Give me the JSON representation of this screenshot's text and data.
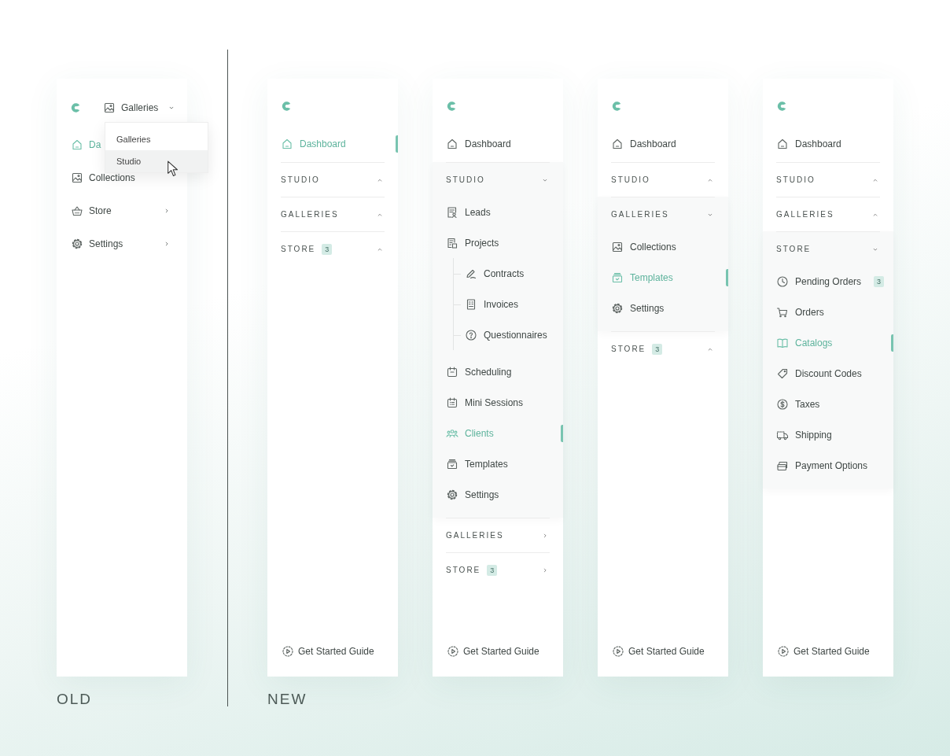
{
  "old": {
    "label": "OLD",
    "switcher": {
      "label": "Galleries"
    },
    "dropdown": [
      {
        "label": "Galleries",
        "selected": false
      },
      {
        "label": "Studio",
        "selected": true
      }
    ],
    "items": [
      {
        "label": "Da",
        "kind": "home",
        "selected": true,
        "submenu": false
      },
      {
        "label": "Collections",
        "kind": "image",
        "selected": false,
        "submenu": false
      },
      {
        "label": "Store",
        "kind": "basket",
        "selected": false,
        "submenu": true
      },
      {
        "label": "Settings",
        "kind": "gear",
        "selected": false,
        "submenu": true
      }
    ]
  },
  "new": {
    "label": "NEW",
    "panels": [
      {
        "nav": [
          {
            "kind": "link",
            "label": "Dashboard",
            "selected": true
          },
          {
            "kind": "section",
            "label": "STUDIO",
            "expanded": false
          },
          {
            "kind": "section",
            "label": "GALLERIES",
            "expanded": false
          },
          {
            "kind": "section",
            "label": "STORE",
            "badge": "3",
            "expanded": false
          }
        ],
        "footer": {
          "label": "Get Started Guide"
        }
      },
      {
        "nav": [
          {
            "kind": "link",
            "label": "Dashboard",
            "selected": false
          },
          {
            "kind": "section",
            "label": "STUDIO",
            "expanded": true,
            "items": [
              {
                "label": "Leads",
                "kind": "contact-card",
                "selected": false
              },
              {
                "label": "Projects",
                "kind": "document",
                "selected": false,
                "children": [
                  {
                    "label": "Contracts",
                    "kind": "pen",
                    "selected": false
                  },
                  {
                    "label": "Invoices",
                    "kind": "list-doc",
                    "selected": false
                  },
                  {
                    "label": "Questionnaires",
                    "kind": "question",
                    "selected": false
                  }
                ]
              },
              {
                "label": "Scheduling",
                "kind": "calendar",
                "selected": false
              },
              {
                "label": "Mini Sessions",
                "kind": "calendar-list",
                "selected": false
              },
              {
                "label": "Clients",
                "kind": "people",
                "selected": true
              },
              {
                "label": "Templates",
                "kind": "tray",
                "selected": false
              },
              {
                "label": "Settings",
                "kind": "gear",
                "selected": false
              }
            ]
          },
          {
            "kind": "section-link",
            "label": "GALLERIES",
            "expanded": false
          },
          {
            "kind": "section-link",
            "label": "STORE",
            "badge": "3",
            "expanded": false
          }
        ],
        "footer": {
          "label": "Get Started Guide"
        }
      },
      {
        "nav": [
          {
            "kind": "link",
            "label": "Dashboard",
            "selected": false
          },
          {
            "kind": "section",
            "label": "STUDIO",
            "expanded": false
          },
          {
            "kind": "section",
            "label": "GALLERIES",
            "expanded": true,
            "items": [
              {
                "label": "Collections",
                "kind": "image",
                "selected": false
              },
              {
                "label": "Templates",
                "kind": "tray",
                "selected": true
              },
              {
                "label": "Settings",
                "kind": "gear",
                "selected": false
              }
            ]
          },
          {
            "kind": "section",
            "label": "STORE",
            "badge": "3",
            "expanded": false
          }
        ],
        "footer": {
          "label": "Get Started Guide"
        }
      },
      {
        "nav": [
          {
            "kind": "link",
            "label": "Dashboard",
            "selected": false
          },
          {
            "kind": "section",
            "label": "STUDIO",
            "expanded": false
          },
          {
            "kind": "section",
            "label": "GALLERIES",
            "expanded": false
          },
          {
            "kind": "section",
            "label": "STORE",
            "expanded": true,
            "items": [
              {
                "label": "Pending Orders",
                "kind": "clock",
                "selected": false,
                "badge": "3"
              },
              {
                "label": "Orders",
                "kind": "cart",
                "selected": false
              },
              {
                "label": "Catalogs",
                "kind": "book",
                "selected": true
              },
              {
                "label": "Discount Codes",
                "kind": "tag",
                "selected": false
              },
              {
                "label": "Taxes",
                "kind": "dollar",
                "selected": false
              },
              {
                "label": "Shipping",
                "kind": "truck",
                "selected": false
              },
              {
                "label": "Payment Options",
                "kind": "wallet",
                "selected": false
              }
            ]
          }
        ],
        "footer": {
          "label": "Get Started Guide"
        }
      }
    ]
  }
}
